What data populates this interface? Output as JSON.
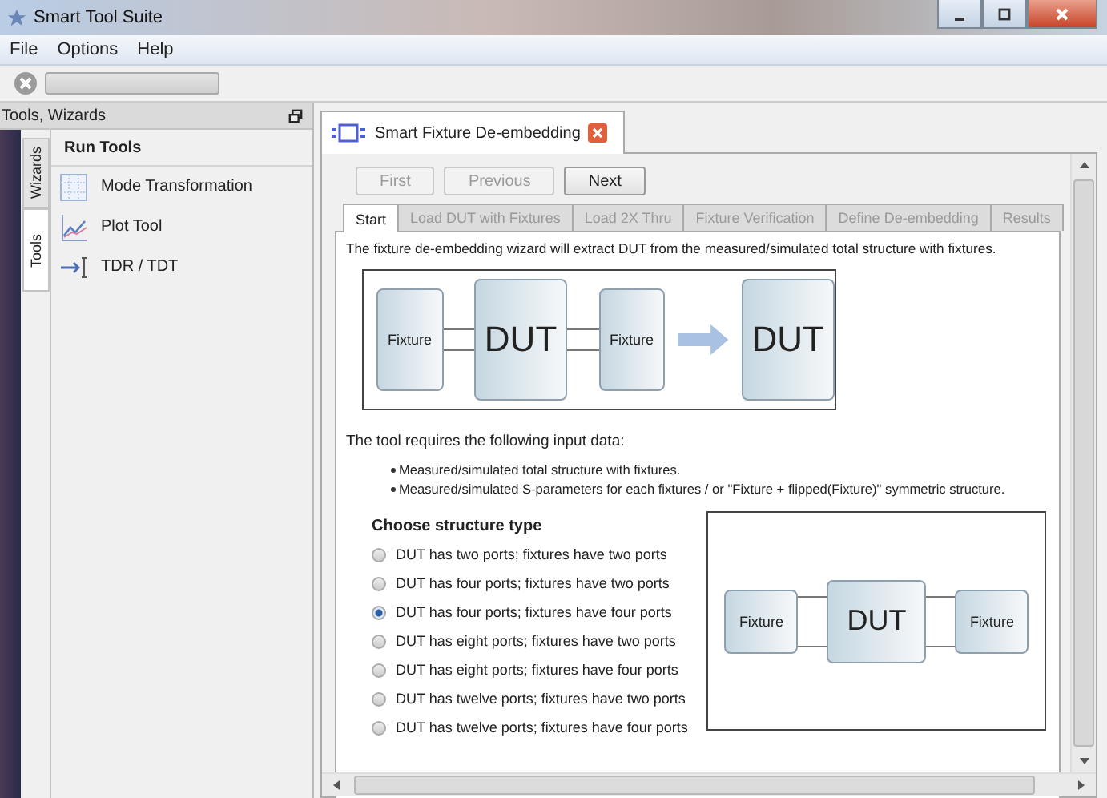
{
  "window": {
    "title": "Smart Tool Suite"
  },
  "menu": [
    "File",
    "Options",
    "Help"
  ],
  "left_panel": {
    "title": "Tools, Wizards",
    "side_tabs": [
      {
        "label": "Wizards",
        "selected": false
      },
      {
        "label": "Tools",
        "selected": true
      }
    ],
    "section": "Run Tools",
    "items": [
      {
        "kind": "grid",
        "label": "Mode Transformation"
      },
      {
        "kind": "plot",
        "label": "Plot Tool"
      },
      {
        "kind": "tdr",
        "label": "TDR / TDT"
      }
    ]
  },
  "doc_tab": {
    "title": "Smart Fixture De-embedding"
  },
  "nav_buttons": [
    {
      "label": "First",
      "disabled": true
    },
    {
      "label": "Previous",
      "disabled": true
    },
    {
      "label": "Next",
      "disabled": false
    }
  ],
  "wizard_tabs": [
    {
      "label": "Start",
      "selected": true,
      "disabled": false
    },
    {
      "label": "Load DUT with Fixtures",
      "selected": false,
      "disabled": true
    },
    {
      "label": "Load 2X Thru",
      "selected": false,
      "disabled": true
    },
    {
      "label": "Fixture Verification",
      "selected": false,
      "disabled": true
    },
    {
      "label": "Define De-embedding",
      "selected": false,
      "disabled": true
    },
    {
      "label": "Results",
      "selected": false,
      "disabled": true
    }
  ],
  "intro": "The fixture de-embedding wizard will extract DUT from the measured/simulated total structure with fixtures.",
  "diagram": [
    {
      "kind": "fixture",
      "label": "Fixture"
    },
    {
      "kind": "link"
    },
    {
      "kind": "dut",
      "label": "DUT"
    },
    {
      "kind": "link"
    },
    {
      "kind": "fixture",
      "label": "Fixture"
    },
    {
      "kind": "arrow"
    },
    {
      "kind": "dut",
      "label": "DUT"
    }
  ],
  "requirements": {
    "lead": "The tool requires the following input data:",
    "bullets": [
      "Measured/simulated total structure with fixtures.",
      "Measured/simulated S-parameters for each fixtures / or \"Fixture + flipped(Fixture)\" symmetric structure."
    ]
  },
  "structure": {
    "title": "Choose structure type",
    "options": [
      {
        "label": "DUT has two ports; fixtures have two ports",
        "selected": false
      },
      {
        "label": "DUT has four ports; fixtures have two ports",
        "selected": false
      },
      {
        "label": "DUT has four ports; fixtures have four ports",
        "selected": true
      },
      {
        "label": "DUT has eight ports; fixtures have two ports",
        "selected": false
      },
      {
        "label": "DUT has eight ports; fixtures have four ports",
        "selected": false
      },
      {
        "label": "DUT has twelve ports; fixtures have two ports",
        "selected": false
      },
      {
        "label": "DUT has twelve ports; fixtures have four ports",
        "selected": false
      }
    ]
  },
  "preview": [
    {
      "kind": "fixture",
      "label": "Fixture"
    },
    {
      "kind": "link"
    },
    {
      "kind": "dut",
      "label": "DUT"
    },
    {
      "kind": "link"
    },
    {
      "kind": "fixture",
      "label": "Fixture"
    }
  ]
}
